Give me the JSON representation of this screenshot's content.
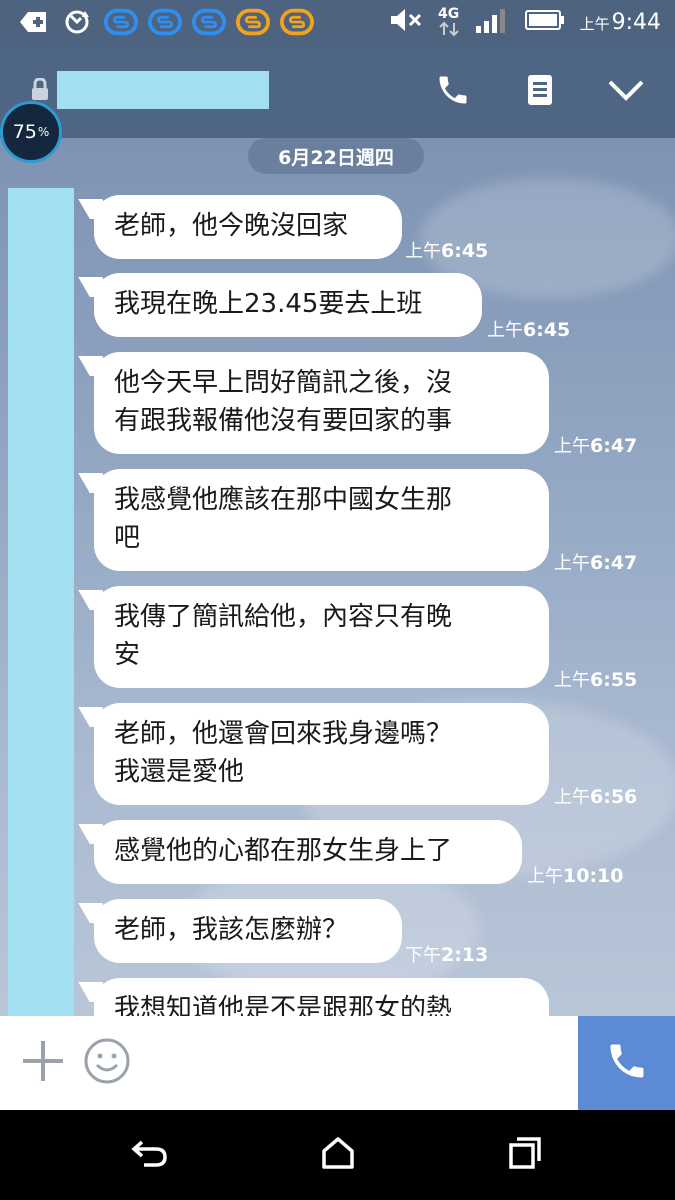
{
  "status_bar": {
    "time_ampm": "上午",
    "time": "9:44",
    "network": "4G"
  },
  "header": {
    "contact_name": "",
    "battery_badge_value": "75",
    "battery_badge_unit": "%"
  },
  "chat": {
    "date_separator": "6月22日週四",
    "messages": [
      {
        "text": "老師，他今晚沒回家",
        "time_ampm": "上午",
        "time": "6:45"
      },
      {
        "text": "我現在晚上23.45要去上班",
        "time_ampm": "上午",
        "time": "6:45"
      },
      {
        "text": "他今天早上問好簡訊之後，沒\n有跟我報備他沒有要回家的事",
        "time_ampm": "上午",
        "time": "6:47"
      },
      {
        "text": "我感覺他應該在那中國女生那\n吧",
        "time_ampm": "上午",
        "time": "6:47"
      },
      {
        "text": "我傳了簡訊給他，內容只有晚\n安",
        "time_ampm": "上午",
        "time": "6:55"
      },
      {
        "text": "老師，他還會回來我身邊嗎？\n我還是愛他",
        "time_ampm": "上午",
        "time": "6:56"
      },
      {
        "text": "感覺他的心都在那女生身上了",
        "time_ampm": "上午",
        "time": "10:10"
      },
      {
        "text": "老師，我該怎麼辦？",
        "time_ampm": "下午",
        "time": "2:13"
      },
      {
        "text": "我想知道他是不是跟那女的熱",
        "time_ampm": "",
        "time": ""
      }
    ]
  },
  "colors": {
    "status_bar": "#4d6380",
    "header": "#4f6584",
    "redacted": "#a2dff0",
    "call_button": "#5c8ad4",
    "bubble": "#ffffff"
  },
  "icons": {
    "status_left": [
      "add-box-icon",
      "sync-icon",
      "app-icon-s-blue",
      "app-icon-s-blue",
      "app-icon-s-blue",
      "app-icon-s-orange",
      "app-icon-s-orange"
    ],
    "status_right": [
      "mute-icon",
      "network-4g-icon",
      "signal-icon",
      "battery-icon"
    ],
    "header": [
      "lock-icon",
      "phone-icon",
      "notes-icon",
      "chevron-down-icon"
    ],
    "input": [
      "plus-icon",
      "emoji-icon",
      "phone-icon"
    ],
    "nav": [
      "back-icon",
      "home-icon",
      "recents-icon"
    ]
  }
}
